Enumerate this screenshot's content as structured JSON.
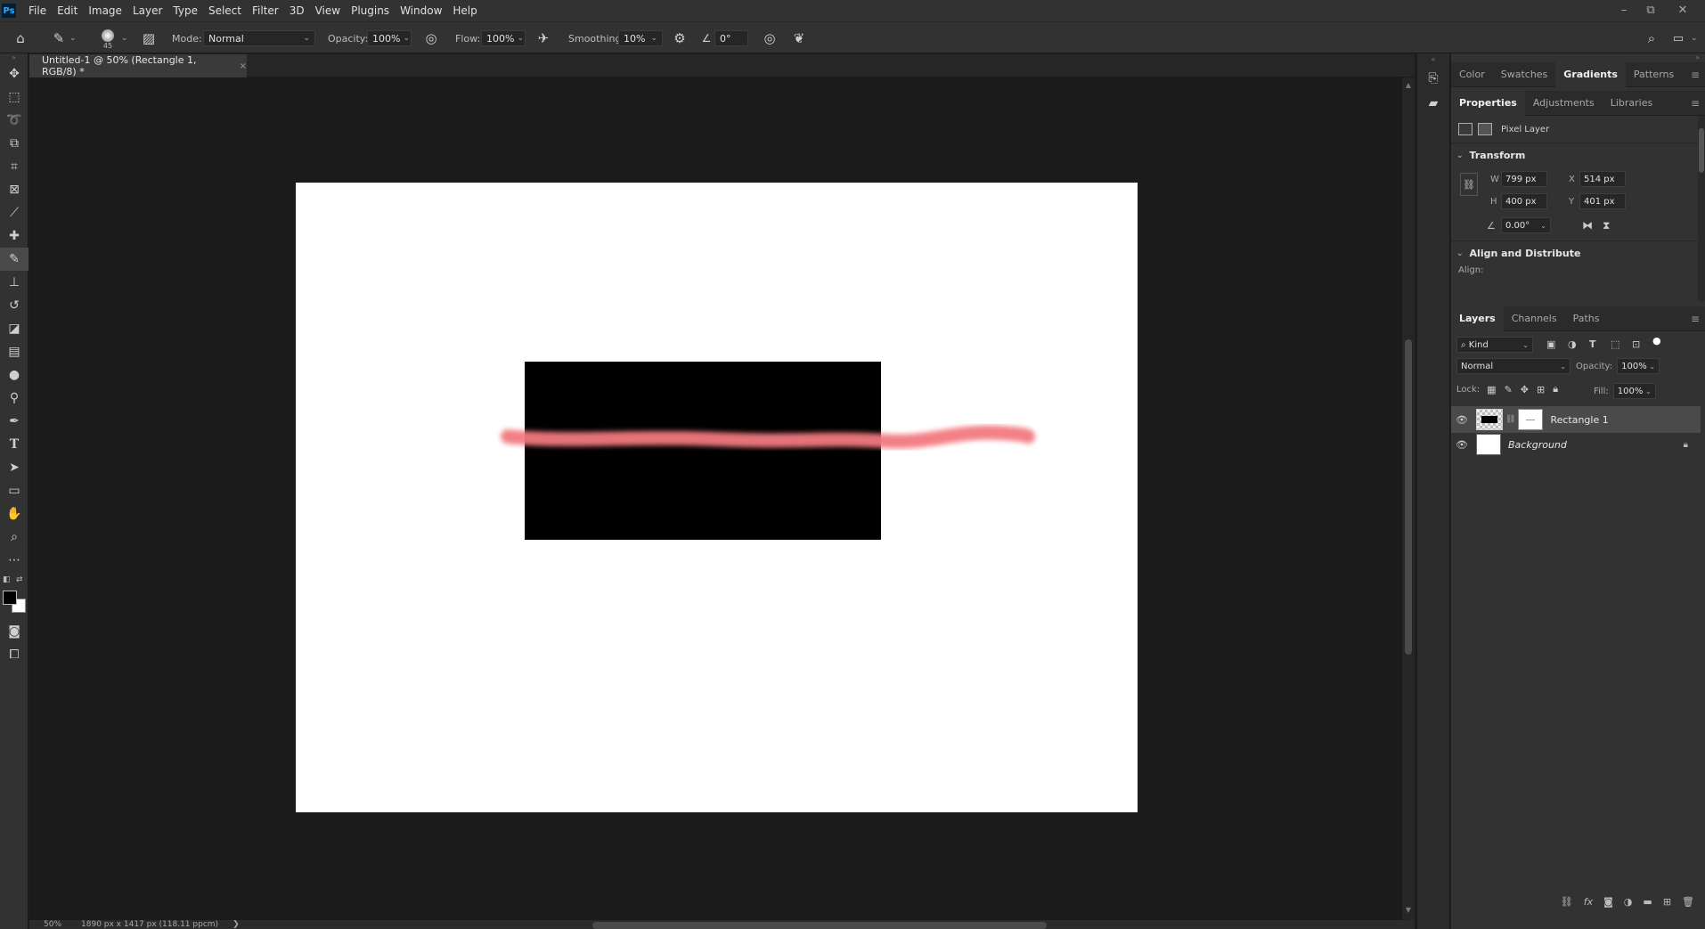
{
  "app": {
    "logo_text": "Ps",
    "menus": [
      "File",
      "Edit",
      "Image",
      "Layer",
      "Type",
      "Select",
      "Filter",
      "3D",
      "View",
      "Plugins",
      "Window",
      "Help"
    ]
  },
  "window_controls": {
    "minimize": "–",
    "restore": "⧉",
    "close": "✕"
  },
  "options_bar": {
    "brush_size": "45",
    "mode_label": "Mode:",
    "mode_value": "Normal",
    "opacity_label": "Opacity:",
    "opacity_value": "100%",
    "flow_label": "Flow:",
    "flow_value": "100%",
    "smoothing_label": "Smoothing:",
    "smoothing_value": "10%",
    "angle_value": "0°"
  },
  "document": {
    "tab_title": "Untitled-1 @ 50% (Rectangle 1, RGB/8) *",
    "tab_close": "×"
  },
  "status_bar": {
    "zoom": "50%",
    "doc_info": "1890 px x 1417 px (118.11 ppcm)",
    "arrow": "❯"
  },
  "top_panel": {
    "tabs": [
      "Color",
      "Swatches",
      "Gradients",
      "Patterns"
    ],
    "active": "Gradients"
  },
  "properties_panel": {
    "tabs": [
      "Properties",
      "Adjustments",
      "Libraries"
    ],
    "active": "Properties",
    "layer_type": "Pixel Layer",
    "transform_title": "Transform",
    "w_label": "W",
    "w_value": "799 px",
    "h_label": "H",
    "h_value": "400 px",
    "x_label": "X",
    "x_value": "514 px",
    "y_label": "Y",
    "y_value": "401 px",
    "angle_value": "0.00°",
    "align_title": "Align and Distribute",
    "align_label": "Align:"
  },
  "layers_panel": {
    "tabs": [
      "Layers",
      "Channels",
      "Paths"
    ],
    "active": "Layers",
    "filter_kind": "Kind",
    "blend_mode": "Normal",
    "opacity_label": "Opacity:",
    "opacity_value": "100%",
    "lock_label": "Lock:",
    "fill_label": "Fill:",
    "fill_value": "100%",
    "layers": [
      {
        "name": "Rectangle 1",
        "visible": true,
        "selected": true
      },
      {
        "name": "Background",
        "visible": true,
        "selected": false,
        "locked": true
      }
    ]
  },
  "colors": {
    "brush_stroke": "#f27a80",
    "foreground": "#000000",
    "background": "#ffffff"
  }
}
